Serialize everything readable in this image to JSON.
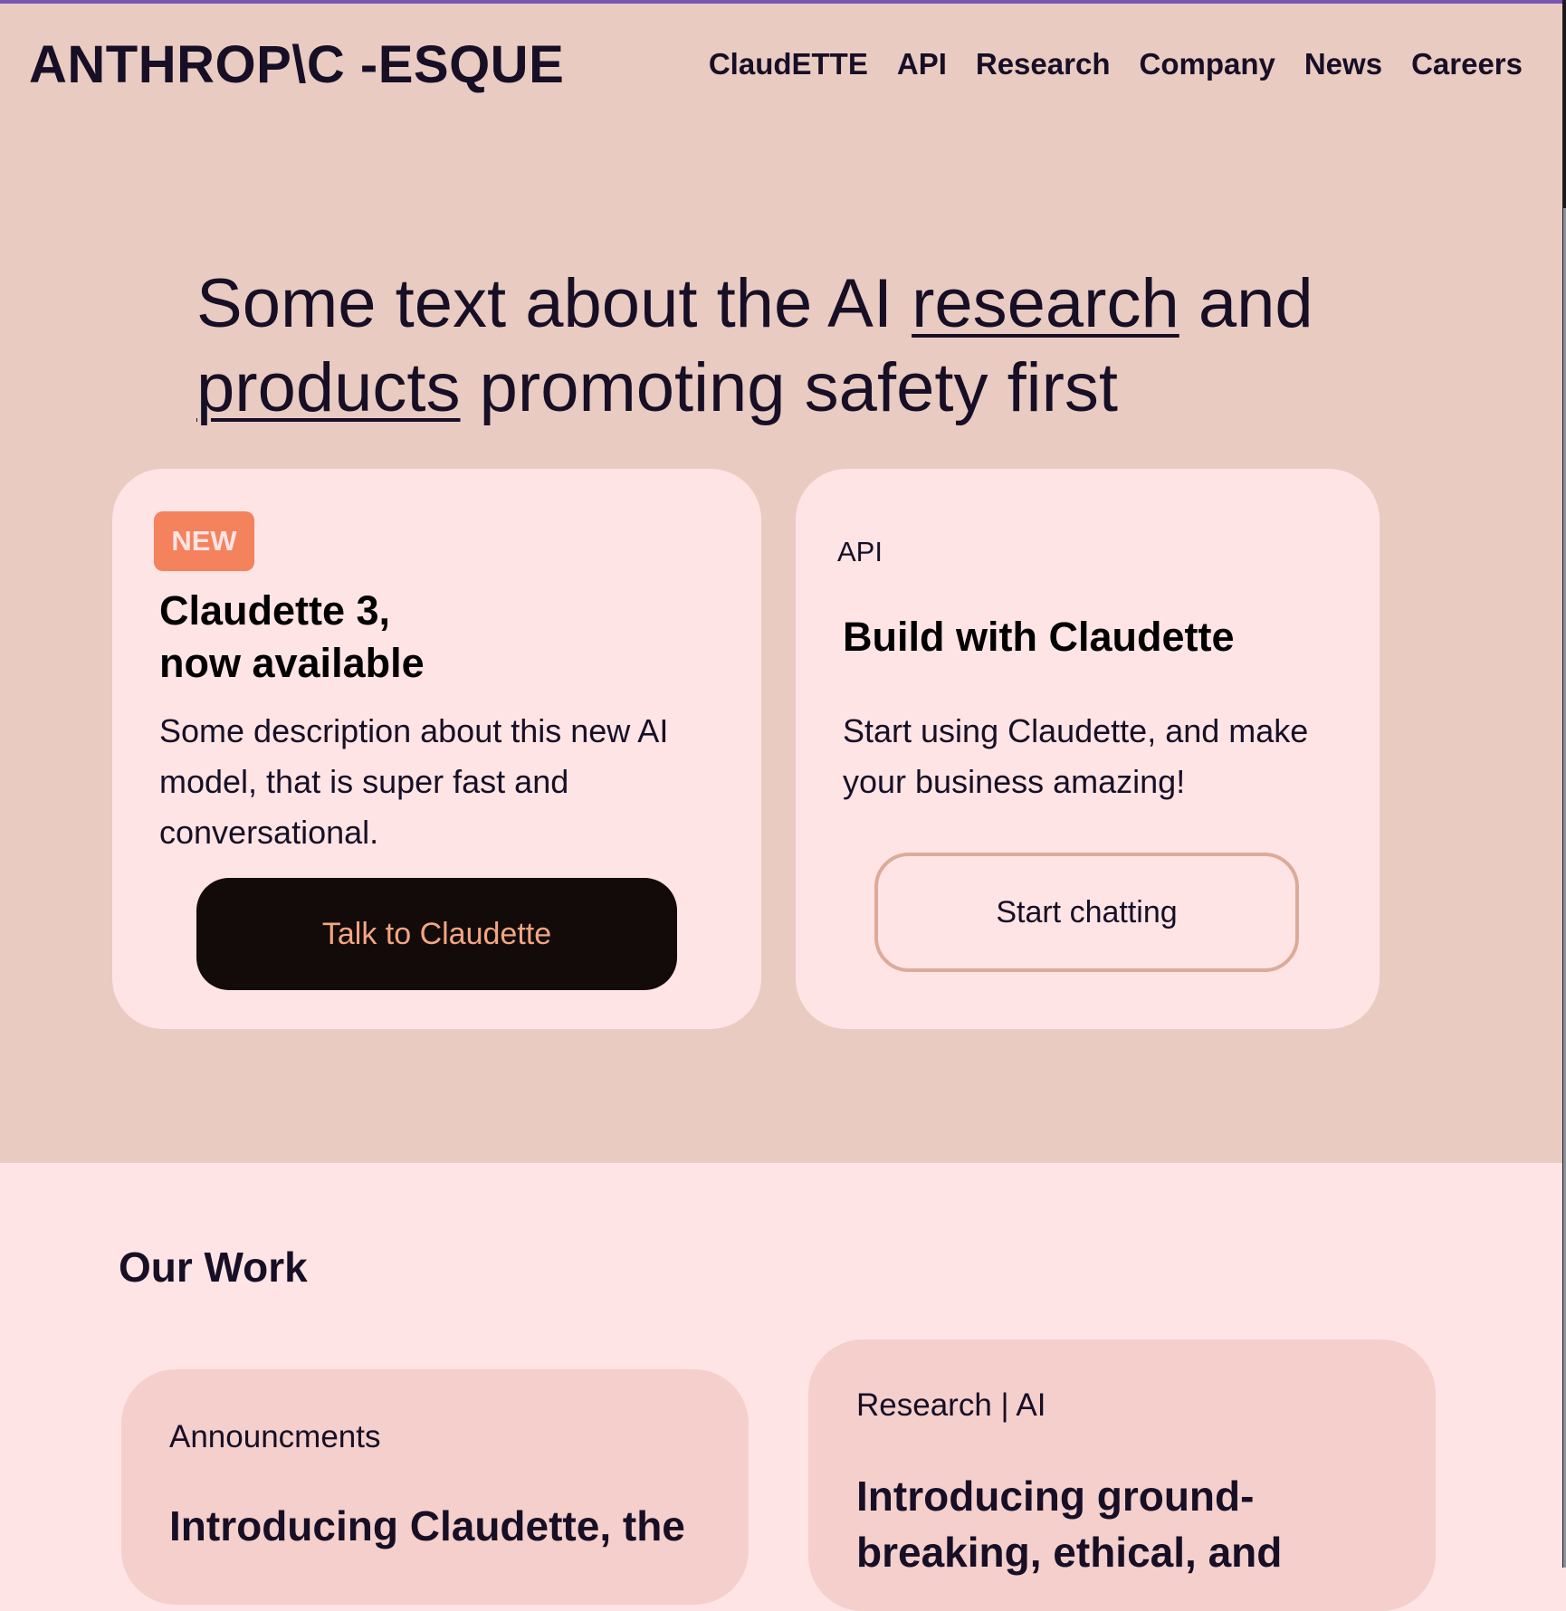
{
  "header": {
    "logo": "ANTHROP\\C -ESQUE",
    "nav": [
      "ClaudETTE",
      "API",
      "Research",
      "Company",
      "News",
      "Careers"
    ]
  },
  "hero": {
    "headline_part1": "Some text about the AI ",
    "headline_link1": "research",
    "headline_part2": " and ",
    "headline_link2": "products",
    "headline_part3": " promoting safety first"
  },
  "cards": [
    {
      "badge": "NEW",
      "title": "Claudette 3,\nnow available",
      "description": "Some description about this new AI model, that is super fast and conversational.",
      "button": "Talk to Claudette"
    },
    {
      "label": "API",
      "title": "Build with Claudette",
      "description": "Start using Claudette, and make your business amazing!",
      "button": "Start chatting"
    }
  ],
  "work": {
    "title": "Our Work",
    "items": [
      {
        "label": "Announcments",
        "title": "Introducing Claudette, the"
      },
      {
        "label": "Research | AI",
        "title": "Introducing ground-breaking, ethical, and"
      }
    ]
  },
  "colors": {
    "hero_bg": "#e9cbc2",
    "page_bg": "#ffe4e5",
    "card_bg": "#ffe4e5",
    "work_card_bg": "#f4cfcc",
    "text": "#160f26",
    "badge": "#f4825c",
    "button_dark": "#120b09",
    "button_dark_text": "#f4a582",
    "button_outline_border": "#dcab98",
    "accent_line": "#7a55b0"
  }
}
